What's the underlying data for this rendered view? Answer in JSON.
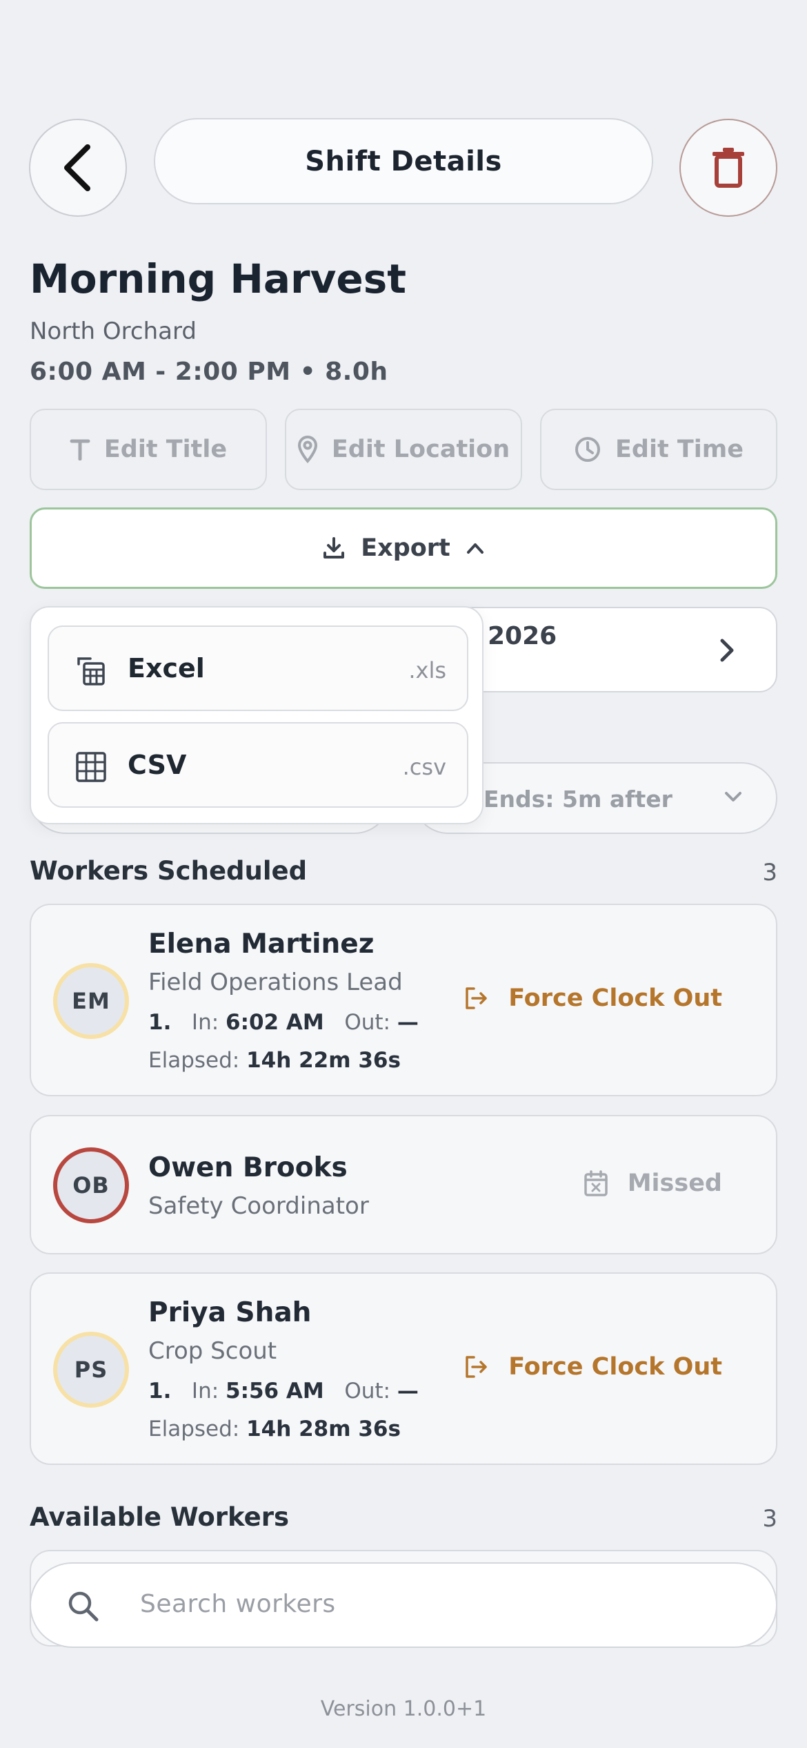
{
  "header": {
    "title": "Shift Details",
    "back_icon": "chevron-left-icon",
    "delete_icon": "trash-icon"
  },
  "shift": {
    "title": "Morning Harvest",
    "location": "North Orchard",
    "time": "6:00 AM - 2:00 PM • 8.0h"
  },
  "actions": {
    "edit_title": "Edit Title",
    "edit_location": "Edit Location",
    "edit_time": "Edit Time",
    "export": "Export"
  },
  "export_menu": {
    "items": [
      {
        "label": "Excel",
        "ext": ".xls",
        "icon": "spreadsheet-icon"
      },
      {
        "label": "CSV",
        "ext": ".csv",
        "icon": "grid-icon"
      }
    ]
  },
  "date_row": {
    "visible_text": "2026"
  },
  "reminder": {
    "ends": "Ends: 5m after"
  },
  "scheduled": {
    "title": "Workers Scheduled",
    "count": "3",
    "workers": [
      {
        "initials": "EM",
        "name": "Elena Martinez",
        "role": "Field Operations Lead",
        "index": "1.",
        "in_label": "In:",
        "in_time": "6:02 AM",
        "out_label": "Out:",
        "out_time": "—",
        "elapsed_label": "Elapsed:",
        "elapsed": "14h 22m 36s",
        "action": "Force Clock Out"
      },
      {
        "initials": "OB",
        "name": "Owen Brooks",
        "role": "Safety Coordinator",
        "status": "Missed"
      },
      {
        "initials": "PS",
        "name": "Priya Shah",
        "role": "Crop Scout",
        "index": "1.",
        "in_label": "In:",
        "in_time": "5:56 AM",
        "out_label": "Out:",
        "out_time": "—",
        "elapsed_label": "Elapsed:",
        "elapsed": "14h 28m 36s",
        "action": "Force Clock Out"
      }
    ]
  },
  "available": {
    "title": "Available Workers",
    "count": "3"
  },
  "search": {
    "placeholder": "Search workers"
  },
  "footer": {
    "version": "Version 1.0.0+1"
  },
  "colors": {
    "accent_orange": "#b5762c",
    "missed_red": "#b8473f",
    "export_border": "#9cc59c",
    "delete_red": "#a8403a"
  }
}
